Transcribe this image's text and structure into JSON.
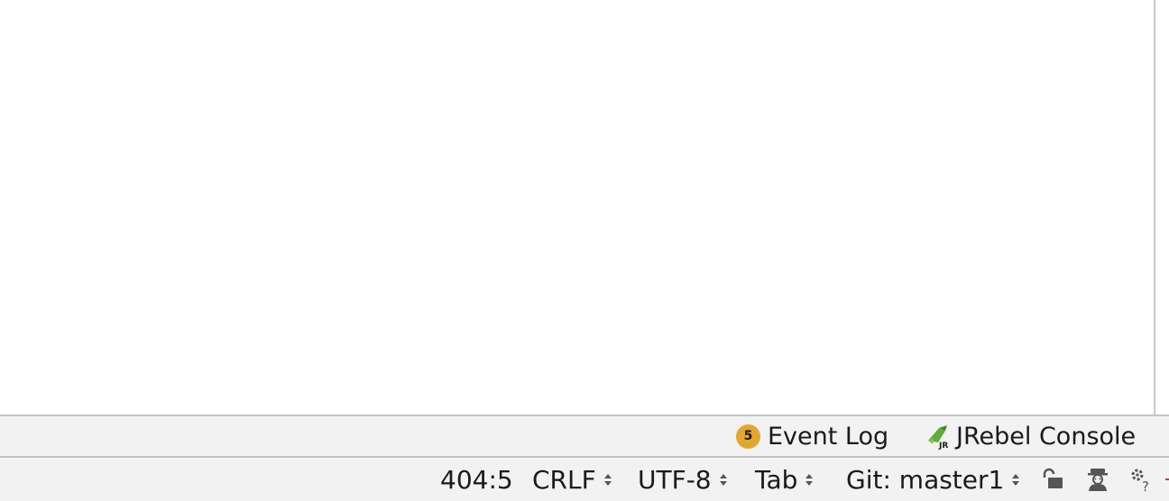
{
  "tool_window_bar": {
    "event_log": {
      "badge_count": "5",
      "label": "Event Log",
      "badge_color": "#e3a72e"
    },
    "jrebel_console": {
      "label": "JRebel Console",
      "icon": "jrebel-icon"
    }
  },
  "status_bar": {
    "caret_position": "404:5",
    "line_separator": "CRLF",
    "encoding": "UTF-8",
    "indent": "Tab",
    "vcs_branch": "Git: master1",
    "icons": [
      "lock-open-icon",
      "hector-inspector-icon",
      "memory-indicator-icon"
    ]
  }
}
